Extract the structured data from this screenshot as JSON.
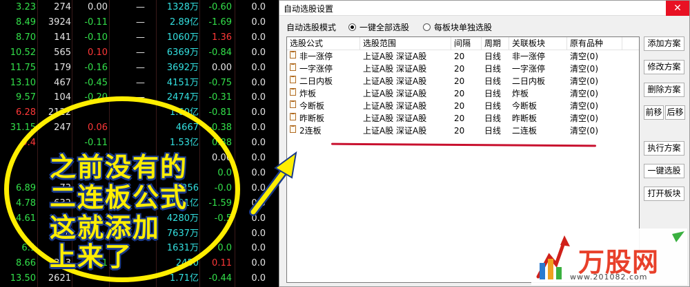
{
  "stock_rows": [
    {
      "c0": "3.23",
      "c0_dir": "dn",
      "c1": "274",
      "c2": "0.00",
      "c2_dir": "fl",
      "c3": "—",
      "c4": "1328万",
      "c5": "-0.60",
      "c5_dir": "dn",
      "c6": "0.0"
    },
    {
      "c0": "8.49",
      "c0_dir": "dn",
      "c1": "3924",
      "c2": "-0.11",
      "c2_dir": "dn",
      "c3": "—",
      "c4": "2.89亿",
      "c5": "-1.69",
      "c5_dir": "dn",
      "c6": "0.0"
    },
    {
      "c0": "8.70",
      "c0_dir": "dn",
      "c1": "141",
      "c2": "-0.10",
      "c2_dir": "dn",
      "c3": "—",
      "c4": "1060万",
      "c5": "1.36",
      "c5_dir": "up",
      "c6": "0.0"
    },
    {
      "c0": "10.52",
      "c0_dir": "dn",
      "c1": "565",
      "c2": "0.10",
      "c2_dir": "up",
      "c3": "—",
      "c4": "6369万",
      "c5": "-0.84",
      "c5_dir": "dn",
      "c6": "0.0"
    },
    {
      "c0": "11.75",
      "c0_dir": "dn",
      "c1": "179",
      "c2": "-0.16",
      "c2_dir": "dn",
      "c3": "—",
      "c4": "3692万",
      "c5": "0.00",
      "c5_dir": "fl",
      "c6": "0.0"
    },
    {
      "c0": "13.10",
      "c0_dir": "dn",
      "c1": "467",
      "c2": "-0.45",
      "c2_dir": "dn",
      "c3": "—",
      "c4": "4151万",
      "c5": "-0.75",
      "c5_dir": "dn",
      "c6": "0.0"
    },
    {
      "c0": "9.57",
      "c0_dir": "dn",
      "c1": "104",
      "c2": "-0.20",
      "c2_dir": "dn",
      "c3": "—",
      "c4": "2474万",
      "c5": "-0.31",
      "c5_dir": "dn",
      "c6": "0.0"
    },
    {
      "c0": "6.28",
      "c0_dir": "up",
      "c1": "2122",
      "c2": "",
      "c2_dir": "fl",
      "c3": "",
      "c4": "1.60亿",
      "c5": "-0.81",
      "c5_dir": "dn",
      "c6": "0.0"
    },
    {
      "c0": "31.15",
      "c0_dir": "dn",
      "c1": "247",
      "c2": "0.06",
      "c2_dir": "up",
      "c3": "",
      "c4": "4667",
      "c5": "-0.38",
      "c5_dir": "dn",
      "c6": "0.0"
    },
    {
      "c0": "9.4",
      "c0_dir": "up",
      "c1": "",
      "c2": "-0.11",
      "c2_dir": "dn",
      "c3": "",
      "c4": "1.53亿",
      "c5": "0.88",
      "c5_dir": "dn",
      "c6": "0.0"
    },
    {
      "c0": "",
      "c0_dir": "dn",
      "c1": "",
      "c2": "",
      "c2_dir": "fl",
      "c3": "",
      "c4": "",
      "c5": "0.00",
      "c5_dir": "fl",
      "c6": "0.0"
    },
    {
      "c0": "",
      "c0_dir": "dn",
      "c1": "",
      "c2": "",
      "c2_dir": "fl",
      "c3": "",
      "c4": "",
      "c5": "0.0",
      "c5_dir": "dn",
      "c6": "0.0"
    },
    {
      "c0": "6.89",
      "c0_dir": "dn",
      "c1": "73",
      "c2": "",
      "c2_dir": "fl",
      "c3": "",
      "c4": "2256",
      "c5": "-0.0",
      "c5_dir": "dn",
      "c6": "0.0"
    },
    {
      "c0": "4.78",
      "c0_dir": "dn",
      "c1": "632",
      "c2": "",
      "c2_dir": "fl",
      "c3": "",
      "c4": "1.91亿",
      "c5": "-1.59",
      "c5_dir": "dn",
      "c6": "0.0"
    },
    {
      "c0": "4.61",
      "c0_dir": "dn",
      "c1": "",
      "c2": "",
      "c2_dir": "fl",
      "c3": "",
      "c4": "4280万",
      "c5": "-0.5",
      "c5_dir": "dn",
      "c6": "0.0"
    },
    {
      "c0": "",
      "c0_dir": "dn",
      "c1": "518",
      "c2": "",
      "c2_dir": "fl",
      "c3": "",
      "c4": "7637万",
      "c5": "",
      "c5_dir": "dn",
      "c6": "0.0"
    },
    {
      "c0": "6.1",
      "c0_dir": "dn",
      "c1": "",
      "c2": "",
      "c2_dir": "fl",
      "c3": "",
      "c4": "1631万",
      "c5": "0.0",
      "c5_dir": "dn",
      "c6": "0.0"
    },
    {
      "c0": "8.66",
      "c0_dir": "dn",
      "c1": "333",
      "c2": "-0.11",
      "c2_dir": "dn",
      "c3": "",
      "c4": "2450",
      "c5": "0.11",
      "c5_dir": "up",
      "c6": "0.0"
    },
    {
      "c0": "13.50",
      "c0_dir": "dn",
      "c1": "2621",
      "c2": "",
      "c2_dir": "fl",
      "c3": "",
      "c4": "1.71亿",
      "c5": "-0.44",
      "c5_dir": "dn",
      "c6": "0.0"
    }
  ],
  "dialog": {
    "title": "自动选股设置",
    "close_glyph": "✕",
    "mode_label": "自动选股模式",
    "radio_all": "一键全部选股",
    "radio_each": "每板块单独选股",
    "columns": [
      "选股公式",
      "选股范围",
      "间隔",
      "周期",
      "关联板块",
      "原有品种"
    ],
    "rows": [
      {
        "formula": "非一涨停",
        "range": "上证A股 深证A股",
        "interval": "20",
        "period": "日线",
        "sector": "非一涨停",
        "orig": "清空(0)"
      },
      {
        "formula": "一字涨停",
        "range": "上证A股 深证A股",
        "interval": "20",
        "period": "日线",
        "sector": "一字涨停",
        "orig": "清空(0)"
      },
      {
        "formula": "二日内板",
        "range": "上证A股 深证A股",
        "interval": "20",
        "period": "日线",
        "sector": "二日内板",
        "orig": "清空(0)"
      },
      {
        "formula": "炸板",
        "range": "上证A股 深证A股",
        "interval": "20",
        "period": "日线",
        "sector": "炸板",
        "orig": "清空(0)"
      },
      {
        "formula": "今断板",
        "range": "上证A股 深证A股",
        "interval": "20",
        "period": "日线",
        "sector": "今断板",
        "orig": "清空(0)"
      },
      {
        "formula": "昨断板",
        "range": "上证A股 深证A股",
        "interval": "20",
        "period": "日线",
        "sector": "昨断板",
        "orig": "清空(0)"
      },
      {
        "formula": "2连板",
        "range": "上证A股 深证A股",
        "interval": "20",
        "period": "日线",
        "sector": "二连板",
        "orig": "清空(0)"
      }
    ],
    "buttons": {
      "add": "添加方案",
      "modify": "修改方案",
      "delete": "删除方案",
      "move_up": "前移",
      "move_down": "后移",
      "execute": "执行方案",
      "one_click": "一键选股",
      "open_sector": "打开板块"
    }
  },
  "annotation": {
    "line1": "之前没有的",
    "line2": "二连板公式",
    "line3": "这就添加",
    "line4": "上来了",
    "color": "#ffee00"
  },
  "watermark": {
    "brand": "万股网",
    "url": "www.201082.com"
  }
}
